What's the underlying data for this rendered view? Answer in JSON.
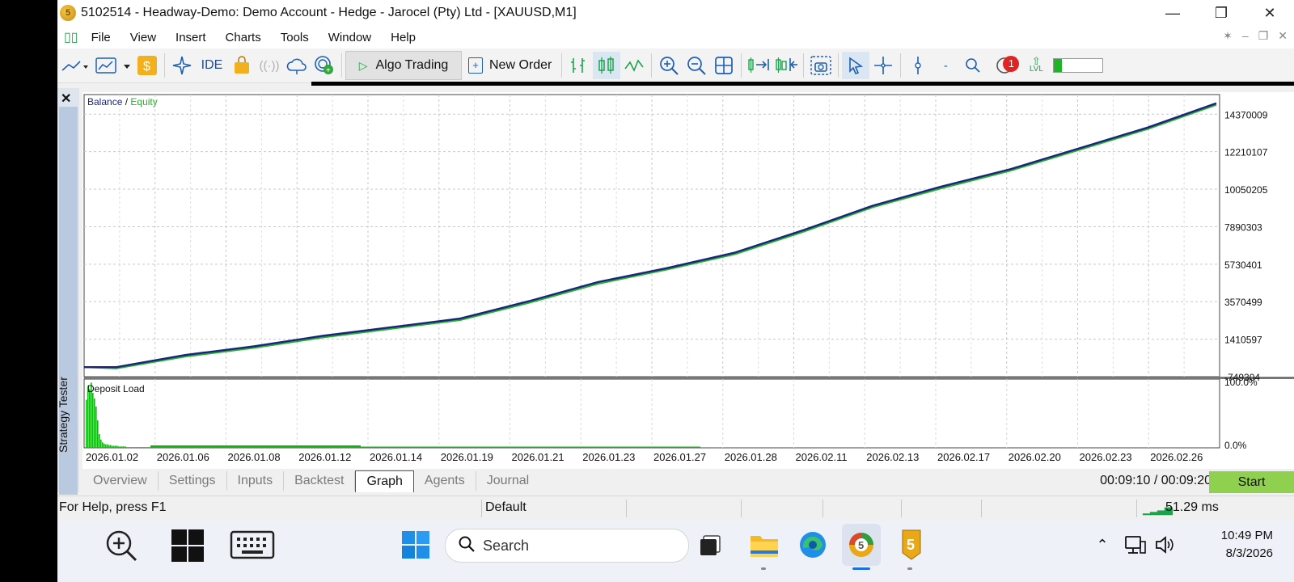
{
  "window": {
    "title": "5102514 - Headway-Demo: Demo Account - Hedge - Jarocel (Pty) Ltd - [XAUUSD,M1]",
    "logo_glyph": "5"
  },
  "menu": [
    "File",
    "View",
    "Insert",
    "Charts",
    "Tools",
    "Window",
    "Help"
  ],
  "toolbar": {
    "ide_label": "IDE",
    "algo_label": "Algo Trading",
    "new_order_label": "New Order",
    "notification_count": "1",
    "lvl_label": "LVL"
  },
  "chart": {
    "balance_label": "Balance",
    "legend_sep": " / ",
    "equity_label": "Equity",
    "deposit_label": "Deposit Load",
    "balance_color": "#1a237e",
    "equity_color": "#22b22a",
    "deposit_color": "#11b511"
  },
  "chart_data": {
    "type": "line",
    "title": "",
    "x_ticks": [
      "2026.01.02",
      "2026.01.06",
      "2026.01.08",
      "2026.01.12",
      "2026.01.14",
      "2026.01.19",
      "2026.01.21",
      "2026.01.23",
      "2026.01.27",
      "2026.01.28",
      "2026.02.11",
      "2026.02.13",
      "2026.02.17",
      "2026.02.20",
      "2026.02.23",
      "2026.02.26"
    ],
    "y_ticks": [
      "14370009",
      "12210107",
      "10050205",
      "7890303",
      "5730401",
      "3570499",
      "1410597",
      "-749304"
    ],
    "ylim": [
      -749304,
      15500000
    ],
    "series": [
      {
        "name": "Balance",
        "values": [
          -200000,
          500000,
          1000000,
          1600000,
          2100000,
          2600000,
          3600000,
          4700000,
          5500000,
          6400000,
          7700000,
          9100000,
          10200000,
          11200000,
          12400000,
          13600000,
          15000000
        ]
      },
      {
        "name": "Equity",
        "values": [
          -200000,
          480000,
          980000,
          1580000,
          2080000,
          2580000,
          3570000,
          4670000,
          5480000,
          6380000,
          7680000,
          9080000,
          10170000,
          11180000,
          12380000,
          13580000,
          14980000
        ]
      }
    ],
    "deposit_load": {
      "y_ticks": [
        "100.0%",
        "0.0%"
      ],
      "values_percent": [
        70,
        90,
        85,
        95,
        80,
        72,
        60,
        40,
        20,
        12,
        8,
        6,
        5,
        5,
        4,
        4,
        3,
        3,
        3,
        3,
        2,
        2,
        2,
        2,
        2,
        1,
        1,
        1,
        1,
        1,
        1,
        1,
        1,
        1,
        1,
        1,
        1,
        1,
        1,
        1
      ]
    }
  },
  "tabs": [
    "Overview",
    "Settings",
    "Inputs",
    "Backtest",
    "Graph",
    "Agents",
    "Journal"
  ],
  "active_tab": "Graph",
  "timer": "00:09:10 / 00:09:20",
  "start_label": "Start",
  "side_label": "Strategy Tester",
  "status": {
    "help": "For Help, press F1",
    "profile": "Default",
    "ping": "51.29 ms"
  },
  "taskbar": {
    "search_placeholder": "Search",
    "time": "10:49 PM",
    "date": "8/3/2026"
  }
}
